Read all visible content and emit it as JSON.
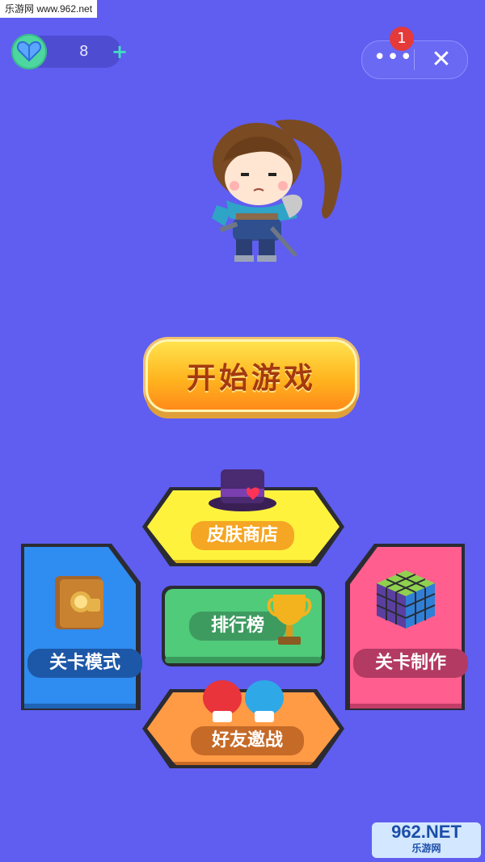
{
  "watermark": "乐游网 www.962.net",
  "lives": {
    "count": "8",
    "plus": "+"
  },
  "capsule": {
    "more": "•••",
    "close": "✕",
    "badge": "1"
  },
  "start_button": "开始游戏",
  "menu": {
    "skin_shop": "皮肤商店",
    "level_mode": "关卡模式",
    "leaderboard": "排行榜",
    "level_make": "关卡制作",
    "friend_battle": "好友邀战"
  },
  "corner_logo": {
    "main": "962.NET",
    "sub": "乐游网"
  },
  "colors": {
    "background": "#5f5ef0",
    "shop": "#fff23d",
    "level_mode": "#2f8cf0",
    "leaderboard": "#4fcb7a",
    "level_make": "#ff5e8e",
    "friend_battle": "#ff9a45"
  }
}
